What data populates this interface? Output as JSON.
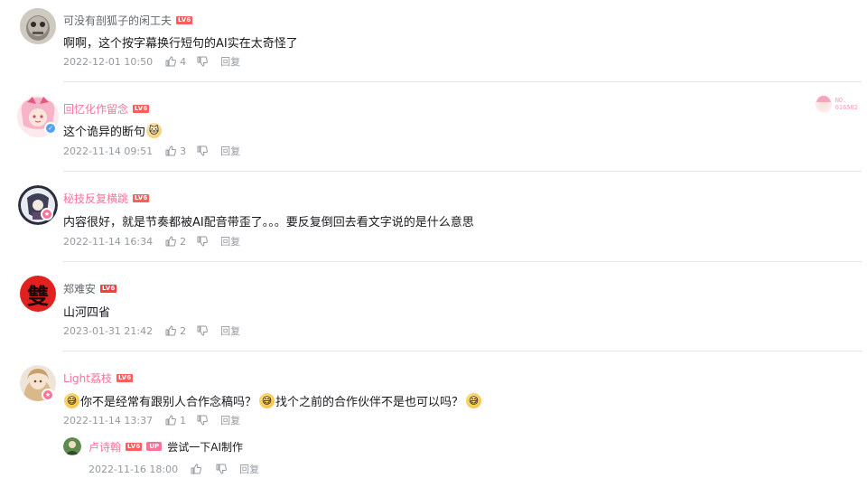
{
  "comments": [
    {
      "username": "可没有剖狐子的闲工夫",
      "level": "LV6",
      "text": "啊啊，这个按字幕换行短句的AI实在太奇怪了",
      "time": "2022-12-01 10:50",
      "likes": "4",
      "reply": "回复"
    },
    {
      "username": "回忆化作留念",
      "level": "LV6",
      "text": "这个诡异的断句",
      "time": "2022-11-14 09:51",
      "likes": "3",
      "reply": "回复",
      "fan_no_label": "NO.",
      "fan_no": "016582"
    },
    {
      "username": "秘技反复横跳",
      "level": "LV6",
      "text": "内容很好，就是节奏都被AI配音带歪了。。。要反复倒回去看文字说的是什么意思",
      "time": "2022-11-14 16:34",
      "likes": "2",
      "reply": "回复"
    },
    {
      "username": "郑难安",
      "level": "LV6",
      "text": "山河四省",
      "time": "2023-01-31 21:42",
      "likes": "2",
      "reply": "回复",
      "avatar_char": "雙"
    },
    {
      "username": "Light荔枝",
      "level": "LV6",
      "text_part1": "你不是经常有跟别人合作念稿吗？",
      "text_part2": "找个之前的合作伙伴不是也可以吗？",
      "time": "2022-11-14 13:37",
      "likes": "1",
      "reply": "回复",
      "sub_reply": {
        "username": "卢诗翰",
        "level": "LV6",
        "up_badge": "UP",
        "text": "尝试一下AI制作",
        "time": "2022-11-16 18:00",
        "reply": "回复"
      }
    }
  ],
  "colors": {
    "accent_pink": "#fb7299",
    "level_red": "#ff5c5c",
    "meta_gray": "#9499a0",
    "divider": "#e3e5e7"
  },
  "icons": {
    "like": "thumbs-up-icon",
    "dislike": "thumbs-down-icon",
    "emoji_face": "emoji-face-icon"
  }
}
